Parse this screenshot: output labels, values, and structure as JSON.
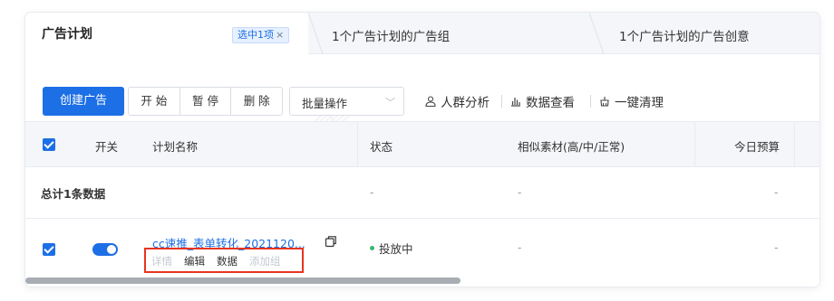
{
  "tabs": {
    "active_title": "广告计划",
    "selected_badge": "选中1项",
    "selected_badge_close": "×",
    "tab2_label": "1个广告计划的广告组",
    "tab3_label": "1个广告计划的广告创意"
  },
  "toolbar": {
    "create_label": "创建广告",
    "start_label": "开 始",
    "pause_label": "暂 停",
    "delete_label": "删 除",
    "batch_label": "批量操作",
    "audience_label": "人群分析",
    "data_view_label": "数据查看",
    "cleanup_label": "一键清理"
  },
  "table": {
    "headers": {
      "switch": "开关",
      "plan_name": "计划名称",
      "status": "状态",
      "similar_material": "相似素材(高/中/正常)",
      "today_budget": "今日预算"
    },
    "total_row": {
      "label": "总计1条数据",
      "status": "-",
      "similar_material": "-",
      "today_budget": "-"
    },
    "rows": [
      {
        "plan_name": "cc速推_表单转化_2021120...",
        "ops": {
          "detail": "详情",
          "edit": "编辑",
          "data": "数据",
          "add_group": "添加组"
        },
        "status": "投放中",
        "similar_material": "-",
        "today_budget": "-"
      }
    ]
  },
  "colors": {
    "accent": "#1d6fe6",
    "status_running": "#38b86f",
    "highlight_box": "#e8351e"
  }
}
